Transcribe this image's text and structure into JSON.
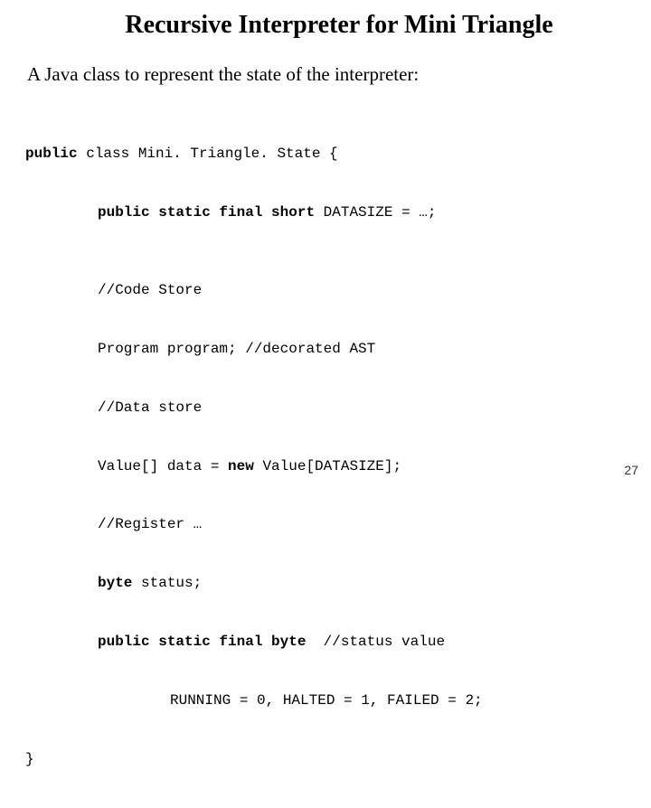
{
  "title": "Recursive Interpreter for Mini Triangle",
  "subtitle": "A Java class to represent the state of the interpreter:",
  "code": {
    "l01a": "public",
    "l01b": " class Mini. Triangle. State {",
    "l02a": "public static final short",
    "l02b": " DATASIZE = …;",
    "l03": "//Code Store",
    "l04": "Program program; //decorated AST",
    "l05": "//Data store",
    "l06a": "Value[] data = ",
    "l06b": "new",
    "l06c": " Value[DATASIZE];",
    "l07": "//Register …",
    "l08a": "byte",
    "l08b": " status;",
    "l09a": "public static final byte",
    "l09b": "  //status value",
    "l10": "RUNNING = 0, HALTED = 1, FAILED = 2;",
    "l11": "}"
  },
  "page_number": "27"
}
